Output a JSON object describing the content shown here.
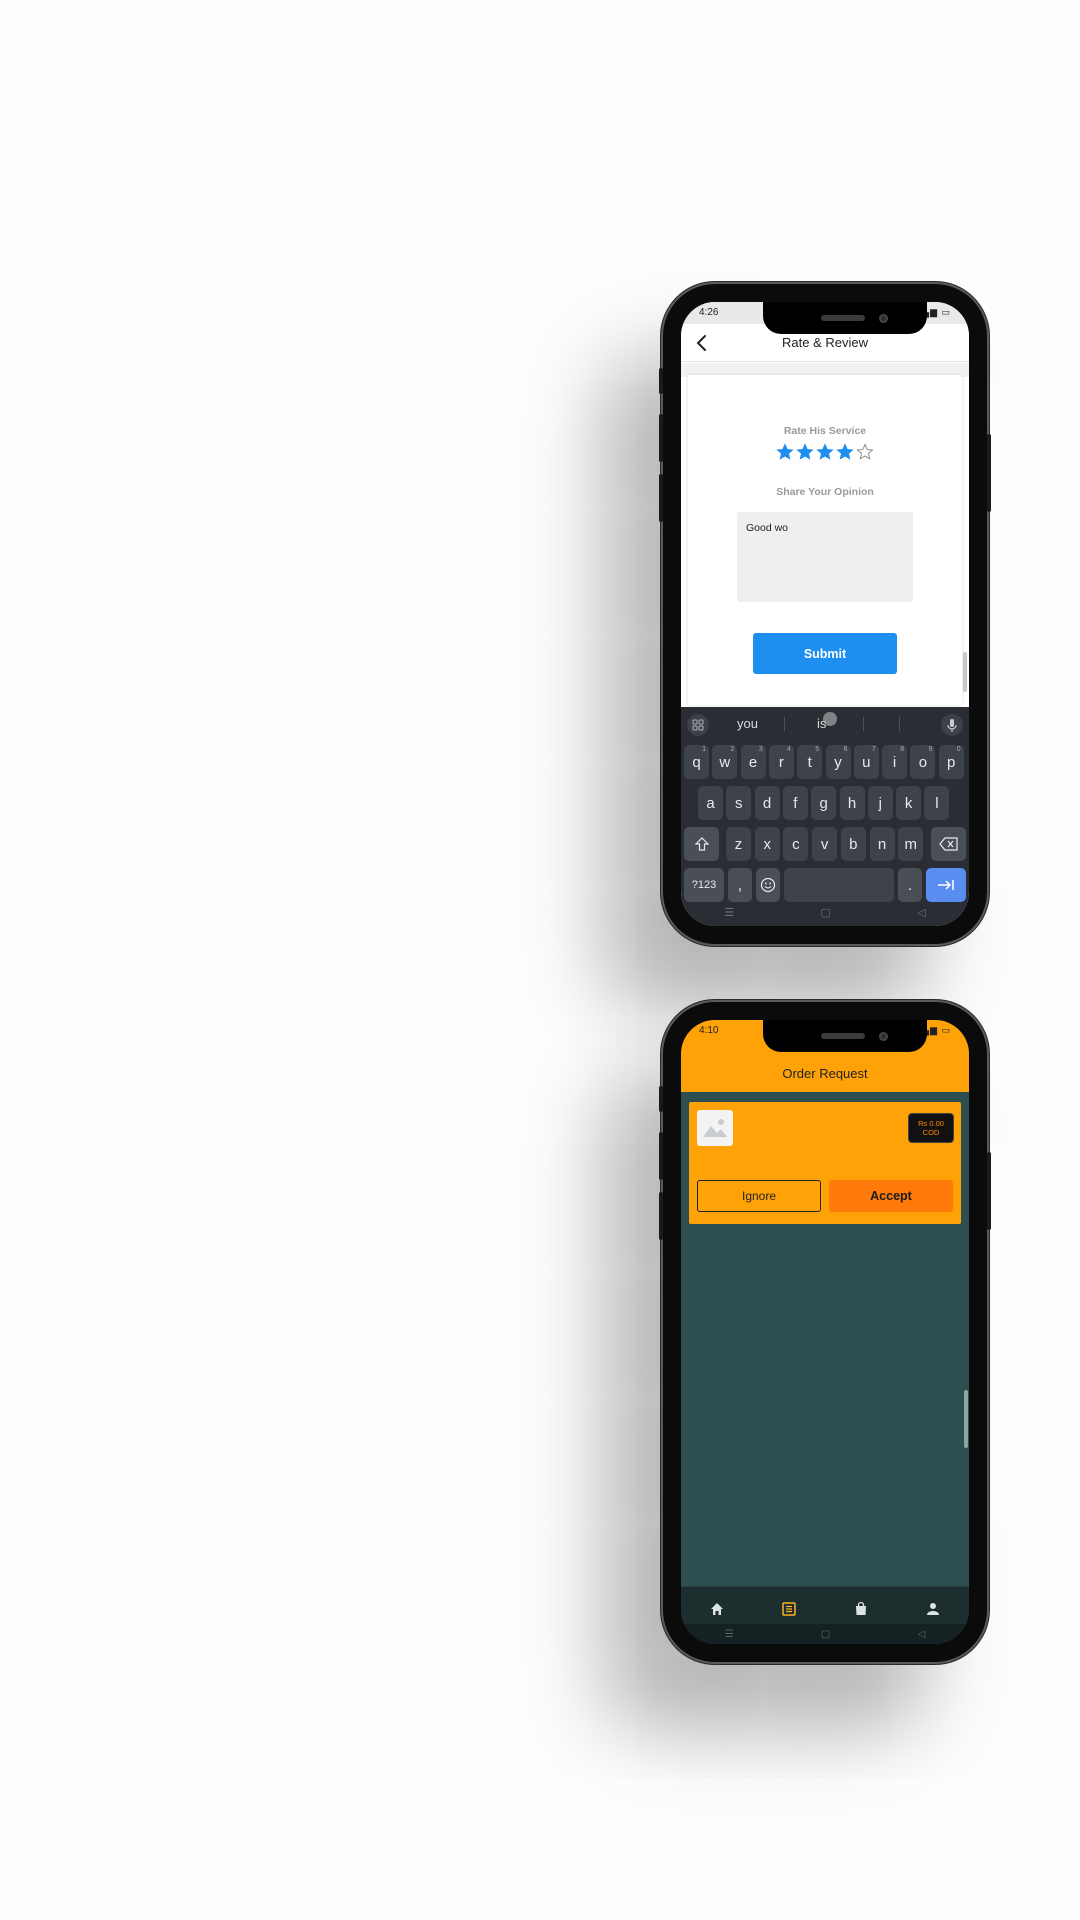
{
  "phone1": {
    "status_time": "4:26",
    "header": {
      "title": "Rate & Review"
    },
    "rate_label": "Rate His Service",
    "rating": {
      "value": 4,
      "max": 5
    },
    "opinion_label": "Share Your Opinion",
    "opinion_text": "Good wo",
    "submit_label": "Submit",
    "keyboard": {
      "suggestions": [
        "you",
        "is",
        ""
      ],
      "row1": [
        {
          "k": "q",
          "h": "1"
        },
        {
          "k": "w",
          "h": "2"
        },
        {
          "k": "e",
          "h": "3"
        },
        {
          "k": "r",
          "h": "4"
        },
        {
          "k": "t",
          "h": "5"
        },
        {
          "k": "y",
          "h": "6"
        },
        {
          "k": "u",
          "h": "7"
        },
        {
          "k": "i",
          "h": "8"
        },
        {
          "k": "o",
          "h": "9"
        },
        {
          "k": "p",
          "h": "0"
        }
      ],
      "row2": [
        "a",
        "s",
        "d",
        "f",
        "g",
        "h",
        "j",
        "k",
        "l"
      ],
      "row3": [
        "z",
        "x",
        "c",
        "v",
        "b",
        "n",
        "m"
      ],
      "symbols_label": "?123",
      "comma_label": ",",
      "period_label": "."
    }
  },
  "phone2": {
    "status_time": "4:10",
    "header": {
      "title": "Order Request"
    },
    "price_line1": "Rs 0.00",
    "price_line2": "COD",
    "ignore_label": "Ignore",
    "accept_label": "Accept",
    "nav_items": [
      "home-icon",
      "orders-list-icon",
      "shopping-bag-icon",
      "profile-icon"
    ],
    "active_nav": 1
  },
  "colors": {
    "accent_blue": "#1f8ef1",
    "orange": "#ffa208",
    "accept_orange": "#ff7a0a",
    "teal_bg": "#2d4f50"
  }
}
